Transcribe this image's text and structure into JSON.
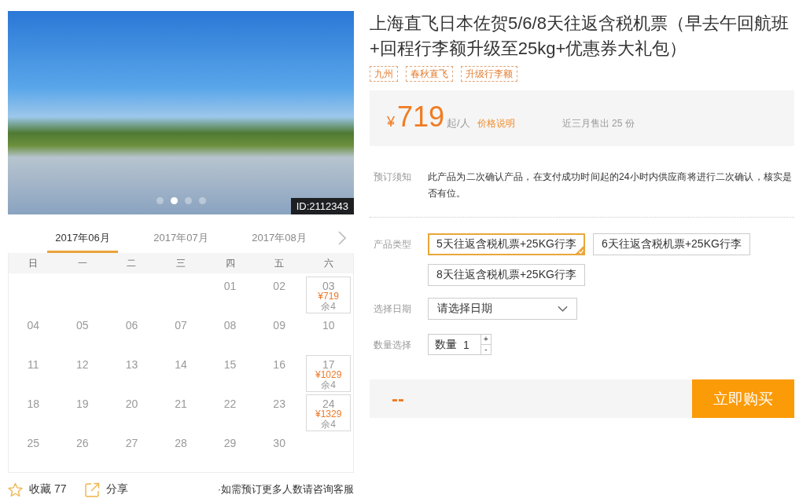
{
  "gallery": {
    "badge": "ID:2112343",
    "dots": [
      {
        "selected": false
      },
      {
        "selected": true
      },
      {
        "selected": false
      },
      {
        "selected": false
      }
    ]
  },
  "calendar": {
    "months": [
      {
        "label": "2017年06月",
        "selected": true
      },
      {
        "label": "2017年07月",
        "selected": false
      },
      {
        "label": "2017年08月",
        "selected": false
      }
    ],
    "weekdays": [
      "日",
      "一",
      "二",
      "三",
      "四",
      "五",
      "六"
    ],
    "weeks": [
      [
        {
          "day": "01"
        },
        {
          "day": "02"
        },
        {
          "day": "03",
          "price": "¥719",
          "stock": "余4"
        }
      ],
      [
        {
          "day": "04"
        },
        {
          "day": "05"
        },
        {
          "day": "06"
        },
        {
          "day": "07"
        },
        {
          "day": "08"
        },
        {
          "day": "09"
        },
        {
          "day": "10"
        }
      ],
      [
        {
          "day": "11"
        },
        {
          "day": "12"
        },
        {
          "day": "13"
        },
        {
          "day": "14"
        },
        {
          "day": "15"
        },
        {
          "day": "16"
        },
        {
          "day": "17",
          "price": "¥1029",
          "stock": "余4"
        }
      ],
      [
        {
          "day": "18"
        },
        {
          "day": "19"
        },
        {
          "day": "20"
        },
        {
          "day": "21"
        },
        {
          "day": "22"
        },
        {
          "day": "23"
        },
        {
          "day": "24",
          "price": "¥1329",
          "stock": "余4"
        }
      ],
      [
        {
          "day": "25"
        },
        {
          "day": "26"
        },
        {
          "day": "27"
        },
        {
          "day": "28"
        },
        {
          "day": "29"
        },
        {
          "day": "30"
        }
      ]
    ]
  },
  "footer": {
    "favorite": "收藏 77",
    "share": "分享",
    "note": "·如需预订更多人数请咨询客服"
  },
  "product": {
    "title": "上海直飞日本佐贺5/6/8天往返含税机票（早去午回航班+回程行李额升级至25kg+优惠券大礼包）",
    "tags": [
      "九州",
      "春秋直飞",
      "升级行李额"
    ],
    "price": {
      "currency": "¥",
      "amount": "719",
      "unit": "起/人",
      "link": "价格说明",
      "sales": "近三月售出 25 份"
    },
    "notice": {
      "label": "预订须知",
      "text": "此产品为二次确认产品，在支付成功时间起的24小时内供应商将进行二次确认，核实是否有位。"
    },
    "product_type": {
      "label": "产品类型",
      "options": [
        {
          "label": "5天往返含税机票+25KG行李",
          "selected": true
        },
        {
          "label": "6天往返含税机票+25KG行李",
          "selected": false
        },
        {
          "label": "8天往返含税机票+25KG行李",
          "selected": false
        }
      ]
    },
    "date": {
      "label": "选择日期",
      "value": "请选择日期"
    },
    "quantity": {
      "label": "数量选择",
      "prefix": "数量",
      "value": "1",
      "increment": "+",
      "decrement": "-"
    },
    "purchase": {
      "total": "--",
      "button": "立即购买"
    }
  }
}
